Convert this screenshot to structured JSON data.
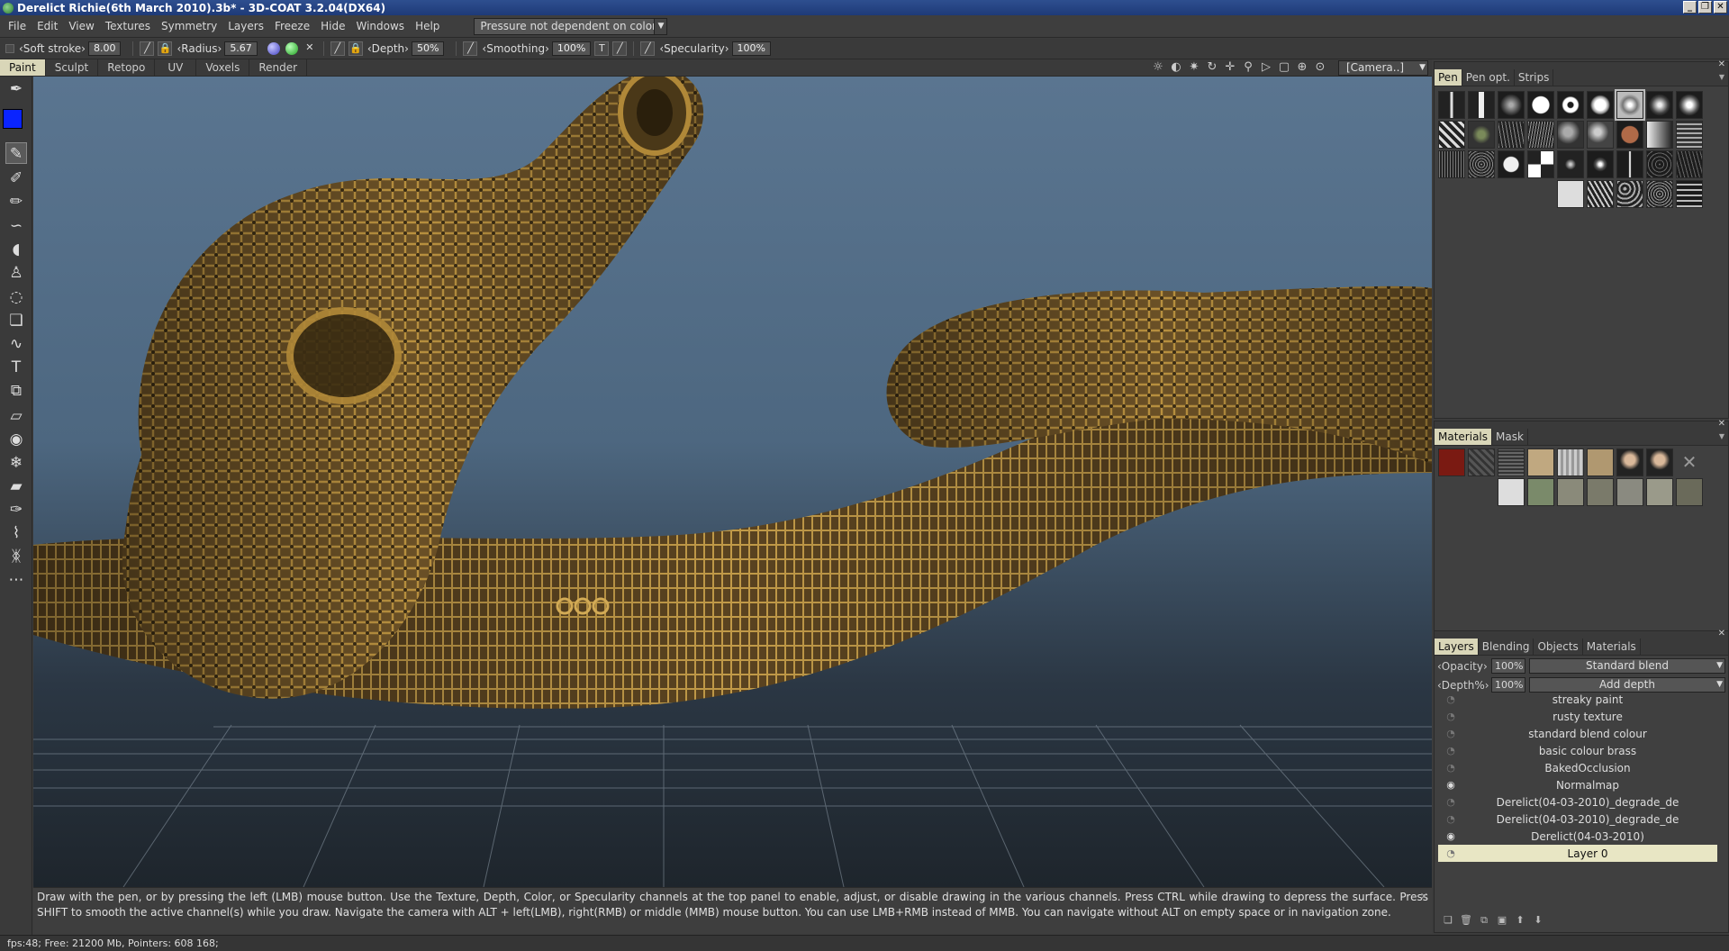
{
  "window": {
    "title": "Derelict Richie(6th March 2010).3b* - 3D-COAT 3.2.04(DX64)",
    "controls": [
      "_",
      "❐",
      "✕"
    ]
  },
  "menu": {
    "items": [
      "File",
      "Edit",
      "View",
      "Textures",
      "Symmetry",
      "Layers",
      "Freeze",
      "Hide",
      "Windows",
      "Help"
    ],
    "pressure_dropdown": "Pressure not dependent on color"
  },
  "tool_options": {
    "stroke_label": "‹Soft stroke›",
    "stroke_value": "8.00",
    "radius_label": "‹Radius›",
    "radius_value": "5.67",
    "depth_label": "‹Depth›",
    "depth_value": "50%",
    "smoothing_label": "‹Smoothing›",
    "smoothing_value": "100%",
    "t_label": "T",
    "specularity_label": "‹Specularity›",
    "specularity_value": "100%"
  },
  "rooms": {
    "tabs": [
      "Paint",
      "Sculpt",
      "Retopo",
      "UV",
      "Voxels",
      "Render"
    ],
    "active": "Paint"
  },
  "navigation": {
    "icons": [
      "☼",
      "◐",
      "✷",
      "↻",
      "✛",
      "⚲",
      "▷",
      "▢",
      "⊕",
      "⊙"
    ],
    "camera_dropdown": "[Camera..]"
  },
  "colors": {
    "primary": "#0a24ff",
    "secondary": "#000000",
    "active_tab": "#d9d6b8",
    "model": "#a8823d"
  },
  "hint": {
    "text": "Draw with the pen, or by pressing the left (LMB) mouse button. Use the Texture, Depth, Color, or Specularity channels at the top panel to enable, adjust, or disable drawing in the various channels. Press CTRL while drawing to depress the surface. Press SHIFT to smooth the active channel(s) while you draw. Navigate the camera with ALT + left(LMB), right(RMB)  or middle (MMB) mouse button. You can use LMB+RMB instead of MMB. You can navigate without ALT on empty space or in navigation zone."
  },
  "status": {
    "text": "fps:48;     Free: 21200 Mb, Pointers: 608 168;"
  },
  "pen_panel": {
    "tabs": [
      "Pen",
      "Pen opt.",
      "Strips"
    ],
    "active": "Pen"
  },
  "materials_panel": {
    "tabs": [
      "Materials",
      "Mask"
    ],
    "active": "Materials"
  },
  "layers_panel": {
    "tabs": [
      "Layers",
      "Blending",
      "Objects",
      "Materials"
    ],
    "active": "Layers",
    "opacity_label": "‹Opacity›",
    "opacity_value": "100%",
    "blend_mode": "Standard blend",
    "depth_label": "‹Depth%›",
    "depth_value": "100%",
    "depth_mode": "Add depth",
    "layers": [
      {
        "name": "streaky paint",
        "visible": false
      },
      {
        "name": "rusty texture",
        "visible": false
      },
      {
        "name": "standard blend colour",
        "visible": false
      },
      {
        "name": "basic colour brass",
        "visible": false
      },
      {
        "name": "BakedOcclusion",
        "visible": false
      },
      {
        "name": "Normalmap",
        "visible": true
      },
      {
        "name": "Derelict(04-03-2010)_degrade_de",
        "visible": false
      },
      {
        "name": "Derelict(04-03-2010)_degrade_de",
        "visible": false
      },
      {
        "name": "Derelict(04-03-2010)",
        "visible": true
      },
      {
        "name": "Layer 0",
        "visible": false,
        "selected": true
      }
    ]
  }
}
